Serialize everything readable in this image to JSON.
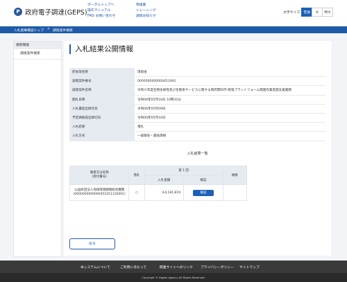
{
  "header": {
    "logo_mark": "P",
    "site_title": "政府電子調達(GEPS)",
    "nav_col1": [
      "ポータルトップへ",
      "操作マニュアル",
      "FAQ･お問い合わせ"
    ],
    "nav_col2": [
      "用語集",
      "トレーニング",
      "調達お知らせ"
    ],
    "font_size_label": "文字サイズ",
    "font_sizes": [
      "普通",
      "大",
      "特大"
    ],
    "font_size_selected": "普通"
  },
  "breadcrumb": {
    "items": [
      "入札結果確認トップ",
      "調達案件検索"
    ],
    "separator": ">"
  },
  "sidebar": {
    "heading": "検索機能",
    "items": [
      "調達案件検索"
    ]
  },
  "page": {
    "title": "入札結果公開情報"
  },
  "info_rows": [
    {
      "label": "府省等名称",
      "value": "環境省"
    },
    {
      "label": "調達案件番号",
      "value": "0000000000000451091"
    },
    {
      "label": "調達案件名称",
      "value": "令和６年度生物多様性及び生態系サービスに関する政府間科学-政策プラットフォーム関連作業実施支援業務"
    },
    {
      "label": "開札日時",
      "value": "令和06年05月16日 10時32分"
    },
    {
      "label": "入札書提出締切日",
      "value": "令和06年05月09日"
    },
    {
      "label": "予定価格提出締切日",
      "value": "令和06年05月16日"
    },
    {
      "label": "入札結果",
      "value": "落札"
    },
    {
      "label": "入札方式",
      "value": "一般競争・最低価格"
    }
  ],
  "results": {
    "title": "入札結果一覧",
    "headers": {
      "bidder": "業者又は名称\n(受付番号)",
      "award": "落札",
      "round": "第 1 回",
      "amount": "入札金額",
      "detail": "検証",
      "remarks": "摘要"
    },
    "rows": [
      {
        "bidder_name": "公益財団法人地球環境戦略研究機関",
        "receipt_no": "(0000000000000451051310001)",
        "award": "○",
        "amount": "\\14,181,819",
        "detail_label": "検証",
        "remarks": ""
      }
    ]
  },
  "back_label": "戻る",
  "footer": {
    "links": [
      "本システムについて",
      "ご利用にあたって",
      "関連サイトへのリンク",
      "プライバシーポリシー",
      "サイトマップ"
    ],
    "copyright": "Copyright © Digital Agency All Rights Reserved."
  },
  "colors": {
    "brand_blue": "#1e5aa8",
    "label_bg": "#e6ebf2",
    "footer_bg": "#3a3a3a"
  }
}
